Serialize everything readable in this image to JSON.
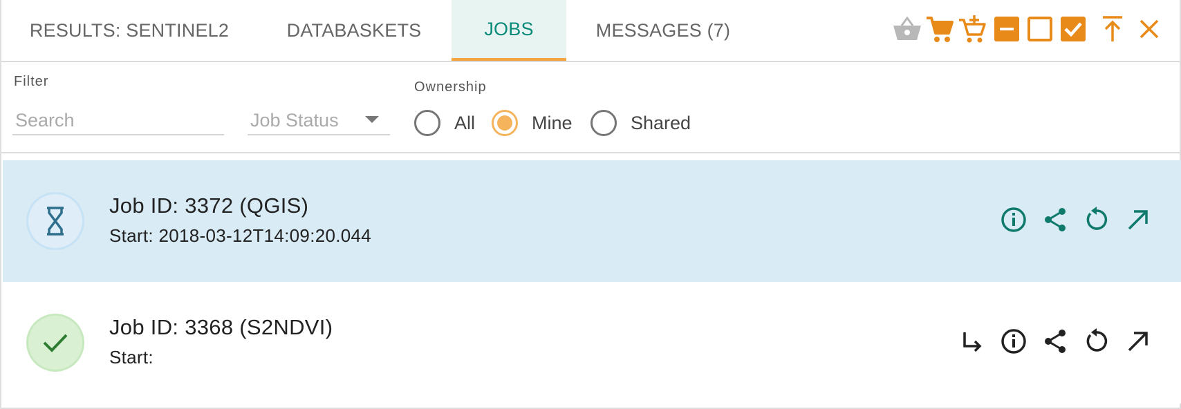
{
  "tabs": [
    {
      "label": "RESULTS: SENTINEL2",
      "active": false
    },
    {
      "label": "DATABASKETS",
      "active": false
    },
    {
      "label": "JOBS",
      "active": true
    },
    {
      "label": "MESSAGES (7)",
      "active": false
    }
  ],
  "toolbar": {
    "icons": [
      "basket-icon",
      "cart-icon",
      "cart-add-icon",
      "minimize-icon",
      "restore-icon",
      "checkbox-icon",
      "move-top-icon",
      "close-icon"
    ],
    "accent_color": "#e88a1a",
    "disabled_color": "#b8b8b8"
  },
  "filter": {
    "filter_label": "Filter",
    "search_placeholder": "Search",
    "search_value": "",
    "status_placeholder": "Job Status",
    "ownership_label": "Ownership",
    "ownership_options": [
      "All",
      "Mine",
      "Shared"
    ],
    "ownership_selected": "Mine"
  },
  "jobs": [
    {
      "title": "Job ID: 3372 (QGIS)",
      "start": "Start: 2018-03-12T14:09:20.044",
      "status": "running",
      "status_icon": "hourglass-icon",
      "row_color": "#d9ebf5",
      "icon_color": "#0f7a6c",
      "actions": [
        "info-icon",
        "share-icon",
        "refresh-icon",
        "open-external-icon"
      ]
    },
    {
      "title": "Job ID: 3368 (S2NDVI)",
      "start": "Start:",
      "status": "completed",
      "status_icon": "check-icon",
      "row_color": "#ffffff",
      "icon_color": "#222222",
      "actions": [
        "output-arrow-icon",
        "info-icon",
        "share-icon",
        "refresh-icon",
        "open-external-icon"
      ]
    }
  ]
}
